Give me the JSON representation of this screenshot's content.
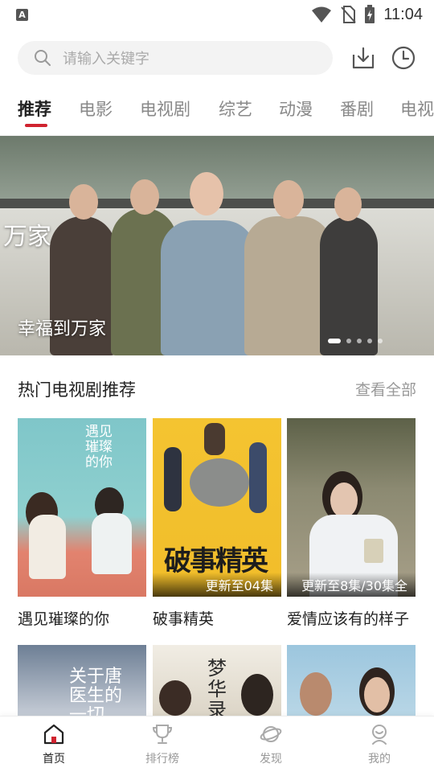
{
  "status_bar": {
    "time": "11:04",
    "app_badge": "A"
  },
  "search": {
    "placeholder": "请输入关键字"
  },
  "header_icons": [
    "download-icon",
    "history-clock-icon"
  ],
  "tabs": [
    {
      "label": "推荐",
      "active": true
    },
    {
      "label": "电影"
    },
    {
      "label": "电视剧"
    },
    {
      "label": "综艺"
    },
    {
      "label": "动漫"
    },
    {
      "label": "番剧"
    },
    {
      "label": "电视"
    }
  ],
  "banner": {
    "title": "幸福到万家",
    "logo_text": "万家",
    "slide_count": 5,
    "active_slide": 1
  },
  "section": {
    "title": "热门电视剧推荐",
    "more_label": "查看全部"
  },
  "cards": [
    {
      "title": "遇见璀璨的你",
      "badge": "",
      "poster_text": "遇见璀璨的你"
    },
    {
      "title": "破事精英",
      "badge": "更新至04集",
      "poster_text": "破事精英"
    },
    {
      "title": "爱情应该有的样子",
      "badge": "更新至8集/30集全",
      "poster_text": ""
    }
  ],
  "row2_posters": [
    {
      "poster_text": "关于唐医生的一切"
    },
    {
      "poster_text": "梦华录"
    },
    {
      "poster_text": ""
    }
  ],
  "bottom_nav": [
    {
      "label": "首页",
      "icon": "home-icon",
      "active": true
    },
    {
      "label": "排行榜",
      "icon": "trophy-icon"
    },
    {
      "label": "发现",
      "icon": "planet-icon"
    },
    {
      "label": "我的",
      "icon": "user-icon"
    }
  ],
  "colors": {
    "accent": "#d0232f",
    "inactive": "#999999"
  }
}
